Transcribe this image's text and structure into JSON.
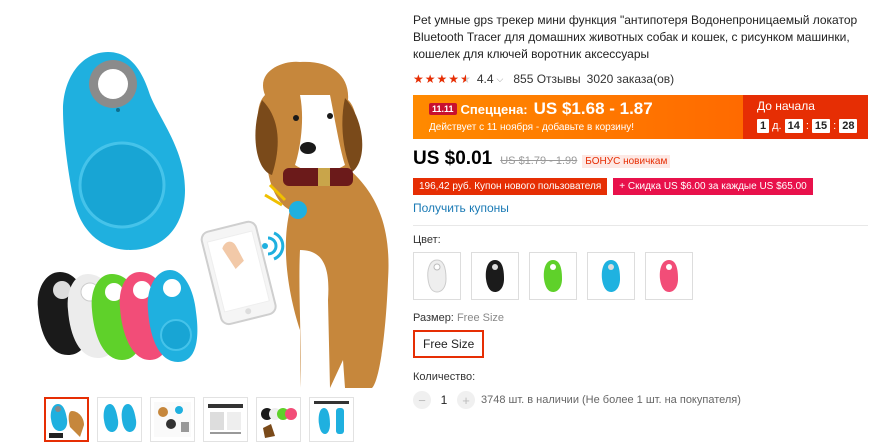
{
  "product": {
    "title": "Pet умные gps трекер мини функция \"антипотеря Водонепроницаемый локатор Bluetooth Tracer для домашних животных собак и кошек, с рисунком машинки, кошелек для ключей воротник аксессуары",
    "rating": "4.4",
    "reviews": "855 Отзывы",
    "orders": "3020 заказа(ов)"
  },
  "promo": {
    "badge": "11.11",
    "label": "Спеццена:",
    "price": "US $1.68 - 1.87",
    "subtitle": "Действует с 11 ноября - добавьте в корзину!",
    "countdown_label": "До начала",
    "days": "1",
    "days_unit": "д.",
    "hours": "14",
    "minutes": "15",
    "seconds": "28"
  },
  "price": {
    "current": "US $0.01",
    "old": "US $1.79 - 1.99",
    "bonus": "БОНУС новичкам"
  },
  "coupons": {
    "new_user": "196,42 руб. Купон нового пользователя",
    "discount": "+ Скидка US $6.00 за каждые US $65.00",
    "get_link": "Получить купоны"
  },
  "options": {
    "color_label": "Цвет:",
    "colors": [
      {
        "name": "white",
        "hex": "#eeeeee"
      },
      {
        "name": "black",
        "hex": "#1b1b1b"
      },
      {
        "name": "green",
        "hex": "#5fd12a"
      },
      {
        "name": "blue",
        "hex": "#1fb2e0"
      },
      {
        "name": "pink",
        "hex": "#f24d78"
      }
    ],
    "size_label": "Размер:",
    "size_value": "Free Size",
    "size_button": "Free Size"
  },
  "quantity": {
    "label": "Количество:",
    "minus": "−",
    "plus": "+",
    "value": "1",
    "stock": "3748 шт. в наличии (Не более 1 шт. на покупателя)"
  },
  "colors": {
    "accent": "#e62e04",
    "promo_orange": "#ff7a00",
    "link": "#1a7ab5"
  }
}
